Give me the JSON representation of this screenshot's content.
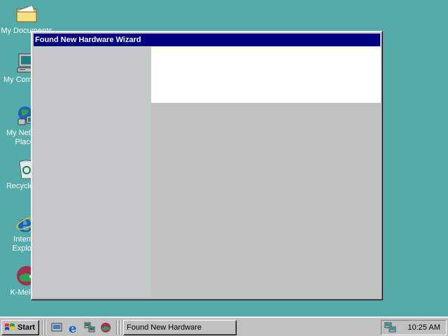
{
  "desktop": {
    "icons": [
      {
        "label": "My Documents",
        "icon": "folder-documents-icon"
      },
      {
        "label": "My Computer",
        "icon": "computer-icon"
      },
      {
        "label": "My Network Places",
        "icon": "network-places-icon"
      },
      {
        "label": "Recycle Bin",
        "icon": "recycle-bin-icon"
      },
      {
        "label": "Internet Explorer",
        "icon": "internet-explorer-icon"
      },
      {
        "label": "K-Meleon",
        "icon": "k-meleon-icon"
      }
    ],
    "background_color": "#55aaaa"
  },
  "window": {
    "title": "Found New Hardware Wizard",
    "titlebar_color": "#000080"
  },
  "taskbar": {
    "start_label": "Start",
    "quick_launch": [
      "show-desktop-icon",
      "internet-explorer-icon",
      "network-icon",
      "k-meleon-icon"
    ],
    "task_button_label": "Found New Hardware",
    "tray_icon": "network-status-icon",
    "clock": "10:25 AM"
  }
}
